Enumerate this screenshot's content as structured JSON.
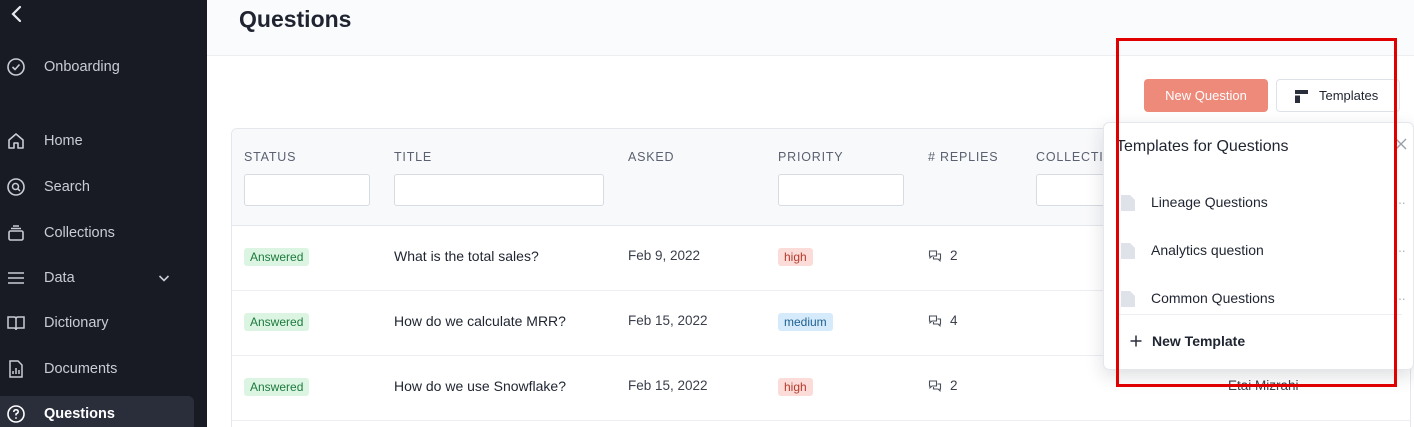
{
  "sidebar": {
    "items": [
      {
        "label": "Onboarding",
        "icon": "check-circle-icon"
      },
      {
        "label": "Home",
        "icon": "home-icon"
      },
      {
        "label": "Search",
        "icon": "search-icon"
      },
      {
        "label": "Collections",
        "icon": "collections-icon"
      },
      {
        "label": "Data",
        "icon": "list-icon"
      },
      {
        "label": "Dictionary",
        "icon": "book-icon"
      },
      {
        "label": "Documents",
        "icon": "document-chart-icon"
      },
      {
        "label": "Questions",
        "icon": "question-circle-icon"
      }
    ]
  },
  "header": {
    "title": "Questions"
  },
  "toolbar": {
    "new_question_label": "New Question",
    "templates_label": "Templates"
  },
  "table": {
    "columns": [
      "STATUS",
      "TITLE",
      "ASKED",
      "PRIORITY",
      "# REPLIES",
      "COLLECTI"
    ],
    "rows": [
      {
        "status": "Answered",
        "title": "What is the total sales?",
        "asked": "Feb 9, 2022",
        "priority": "high",
        "replies": "2",
        "author": ""
      },
      {
        "status": "Answered",
        "title": "How do we calculate MRR?",
        "asked": "Feb 15, 2022",
        "priority": "medium",
        "replies": "4",
        "author": ""
      },
      {
        "status": "Answered",
        "title": "How do we use Snowflake?",
        "asked": "Feb 15, 2022",
        "priority": "high",
        "replies": "2",
        "author": "Etai Mizrahi"
      }
    ]
  },
  "templates_dropdown": {
    "title": "Templates for Questions",
    "items": [
      "Lineage Questions",
      "Analytics question",
      "Common Questions"
    ],
    "more_label": "···",
    "new_template_label": "New Template"
  },
  "colors": {
    "sidebar_bg": "#181b24",
    "accent": "#ee8a7a",
    "highlight": "#e00000"
  }
}
